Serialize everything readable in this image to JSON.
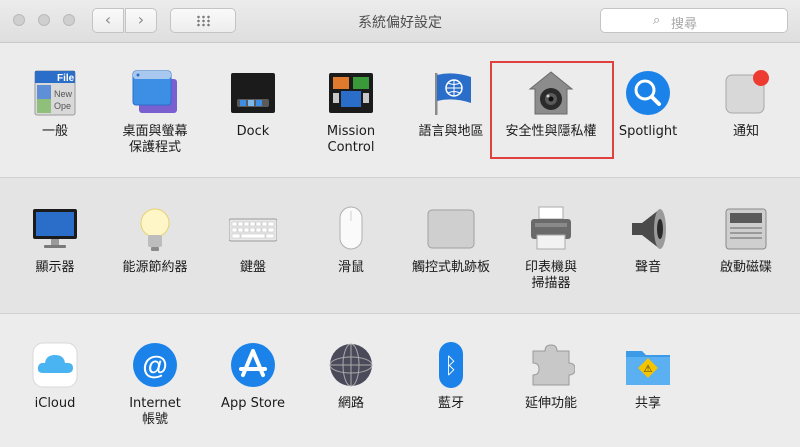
{
  "window": {
    "title": "系統偏好設定"
  },
  "toolbar": {
    "back_icon": "‹",
    "forward_icon": "›"
  },
  "search": {
    "placeholder": "搜尋",
    "icon": "⌕"
  },
  "sections": {
    "personal": [
      {
        "label": "一般",
        "icon": "general-icon"
      },
      {
        "label": "桌面與螢幕\n保護程式",
        "icon": "desktop-screensaver-icon"
      },
      {
        "label": "Dock",
        "icon": "dock-icon"
      },
      {
        "label": "Mission\nControl",
        "icon": "mission-control-icon"
      },
      {
        "label": "語言與地區",
        "icon": "language-region-icon"
      },
      {
        "label": "安全性與隱私權",
        "icon": "security-privacy-icon"
      },
      {
        "label": "Spotlight",
        "icon": "spotlight-icon"
      },
      {
        "label": "通知",
        "icon": "notifications-icon"
      }
    ],
    "hardware": [
      {
        "label": "顯示器",
        "icon": "displays-icon"
      },
      {
        "label": "能源節約器",
        "icon": "energy-saver-icon"
      },
      {
        "label": "鍵盤",
        "icon": "keyboard-icon"
      },
      {
        "label": "滑鼠",
        "icon": "mouse-icon"
      },
      {
        "label": "觸控式軌跡板",
        "icon": "trackpad-icon"
      },
      {
        "label": "印表機與\n掃描器",
        "icon": "printers-scanners-icon"
      },
      {
        "label": "聲音",
        "icon": "sound-icon"
      },
      {
        "label": "啟動磁碟",
        "icon": "startup-disk-icon"
      }
    ],
    "internet": [
      {
        "label": "iCloud",
        "icon": "icloud-icon"
      },
      {
        "label": "Internet\n帳號",
        "icon": "internet-accounts-icon"
      },
      {
        "label": "App Store",
        "icon": "app-store-icon"
      },
      {
        "label": "網路",
        "icon": "network-icon"
      },
      {
        "label": "藍牙",
        "icon": "bluetooth-icon"
      },
      {
        "label": "延伸功能",
        "icon": "extensions-icon"
      },
      {
        "label": "共享",
        "icon": "sharing-icon"
      }
    ]
  },
  "icon_text": {
    "general_file": "File",
    "general_new": "New",
    "general_open": "Ope",
    "internet_at": "@",
    "bluetooth": "ᛒ",
    "sharing_sign": "⚠"
  },
  "colors": {
    "highlight": "#e0403e",
    "accent_blue": "#1a82e8"
  }
}
